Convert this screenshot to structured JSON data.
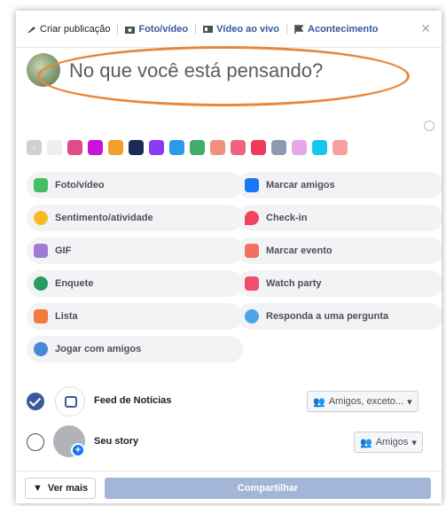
{
  "tabs": [
    {
      "label": "Criar publicação",
      "icon": "pencil-icon"
    },
    {
      "label": "Foto/vídeo",
      "icon": "camera-icon"
    },
    {
      "label": "Vídeo ao vivo",
      "icon": "live-video-icon"
    },
    {
      "label": "Acontecimento",
      "icon": "flag-icon"
    }
  ],
  "composer": {
    "placeholder": "No que você está pensando?",
    "highlight_color": "#e8873a"
  },
  "swatches": [
    "#eceef1",
    "#e24a8c",
    "#c813db",
    "#f0a12a",
    "#1c2b58",
    "#8b3cf2",
    "#2b9ae8",
    "#3fae68",
    "#ef8f7e",
    "#f0637f",
    "#ef3a5a",
    "#8e9aaf",
    "#e6a7e8",
    "#14c7f0",
    "#f6a0a0"
  ],
  "actions": [
    {
      "label": "Foto/vídeo",
      "icon": "photo-icon",
      "color": "#45bd62"
    },
    {
      "label": "Marcar amigos",
      "icon": "tag-friends-icon",
      "color": "#1877f2"
    },
    {
      "label": "Sentimento/atividade",
      "icon": "smiley-icon",
      "color": "#f7b928"
    },
    {
      "label": "Check-in",
      "icon": "location-pin-icon",
      "color": "#f3425f"
    },
    {
      "label": "GIF",
      "icon": "gif-icon",
      "color": "#a07bd6"
    },
    {
      "label": "Marcar evento",
      "icon": "calendar-icon",
      "color": "#f36f60"
    },
    {
      "label": "Enquete",
      "icon": "poll-icon",
      "color": "#2a9b61"
    },
    {
      "label": "Watch party",
      "icon": "popcorn-icon",
      "color": "#ef4f6b"
    },
    {
      "label": "Lista",
      "icon": "list-icon",
      "color": "#f5793b"
    },
    {
      "label": "Responda a uma pergunta",
      "icon": "speech-bubble-icon",
      "color": "#4aa5ea"
    },
    {
      "label": "Jogar com amigos",
      "icon": "gamepad-icon",
      "color": "#4788d8"
    }
  ],
  "feed": {
    "label": "Feed de Notícias",
    "audience": "Amigos, exceto...",
    "checked": true
  },
  "story": {
    "label": "Seu story",
    "audience": "Amigos",
    "checked": false
  },
  "footer": {
    "more_label": "Ver mais",
    "share_label": "Compartilhar"
  }
}
